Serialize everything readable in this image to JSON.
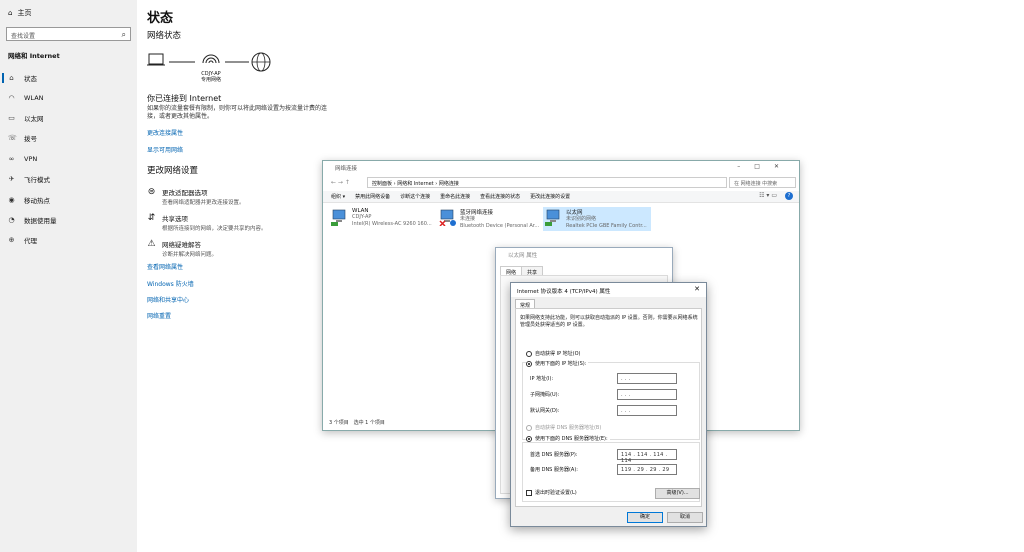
{
  "sidebar": {
    "home": "主页",
    "search_placeholder": "查找设置",
    "category": "网络和 Internet",
    "items": [
      {
        "label": "状态",
        "icon": "home-icon"
      },
      {
        "label": "WLAN",
        "icon": "wifi-icon"
      },
      {
        "label": "以太网",
        "icon": "ethernet-icon"
      },
      {
        "label": "拨号",
        "icon": "dialup-icon"
      },
      {
        "label": "VPN",
        "icon": "vpn-icon"
      },
      {
        "label": "飞行模式",
        "icon": "airplane-icon"
      },
      {
        "label": "移动热点",
        "icon": "hotspot-icon"
      },
      {
        "label": "数据使用量",
        "icon": "data-usage-icon"
      },
      {
        "label": "代理",
        "icon": "globe-icon"
      }
    ]
  },
  "main": {
    "title": "状态",
    "network_status": "网络状态",
    "network_name": "CDJY-AP",
    "network_type": "专用网络",
    "connected_heading": "你已连接到 Internet",
    "connected_desc": "如果你的流量套餐有限制，则你可以将此网络设置为按流量计费的连接，或者更改其他属性。",
    "link_change_props": "更改连接属性",
    "link_show_networks": "显示可用网络",
    "change_settings": "更改网络设置",
    "options": [
      {
        "title": "更改适配器选项",
        "desc": "查看网络适配器并更改连接设置。"
      },
      {
        "title": "共享选项",
        "desc": "根据所连接到的网络，决定要共享的内容。"
      },
      {
        "title": "网络疑难解答",
        "desc": "诊断并解决网络问题。"
      }
    ],
    "link_view_props": "查看网络属性",
    "link_firewall": "Windows 防火墙",
    "link_sharing_center": "网络和共享中心",
    "link_reset": "网络重置"
  },
  "explorer": {
    "title": "网络连接",
    "path": [
      "控制面板",
      "网络和 Internet",
      "网络连接"
    ],
    "search": "在 网络连接 中搜索",
    "toolbar": [
      "组织 ▾",
      "禁用此网络设备",
      "诊断这个连接",
      "重命名此连接",
      "查看此连接的状态",
      "更改此连接的设置"
    ],
    "adapters": [
      {
        "name": "WLAN",
        "line1": "CDJY-AP",
        "line2": "Intel(R) Wireless-AC 9260 160..."
      },
      {
        "name": "蓝牙网络连接",
        "line1": "未连接",
        "line2": "Bluetooth Device (Personal Ar..."
      },
      {
        "name": "以太网",
        "line1": "未识别的网络",
        "line2": "Realtek PCIe GBE Family Contr..."
      }
    ],
    "status_count": "3 个项目",
    "status_selected": "选中 1 个项目"
  },
  "eth_props": {
    "title": "以太网 属性",
    "tabs": [
      "网络",
      "共享"
    ]
  },
  "ipv4": {
    "title": "Internet 协议版本 4 (TCP/IPv4) 属性",
    "tab": "常规",
    "desc": "如果网络支持此功能，则可以获取自动指派的 IP 设置。否则，你需要从网络系统管理员处获得适当的 IP 设置。",
    "auto_ip": "自动获得 IP 地址(O)",
    "manual_ip": "使用下面的 IP 地址(S):",
    "ip_label": "IP 地址(I):",
    "mask_label": "子网掩码(U):",
    "gateway_label": "默认网关(D):",
    "empty_ip": ".   .   .",
    "auto_dns": "自动获得 DNS 服务器地址(B)",
    "manual_dns": "使用下面的 DNS 服务器地址(E):",
    "dns1_label": "首选 DNS 服务器(P):",
    "dns2_label": "备用 DNS 服务器(A):",
    "dns1_value": "114 . 114 . 114 . 114",
    "dns2_value": "119 . 29 . 29 . 29",
    "validate": "退出时验证设置(L)",
    "advanced": "高级(V)...",
    "ok": "确定",
    "cancel": "取消"
  }
}
